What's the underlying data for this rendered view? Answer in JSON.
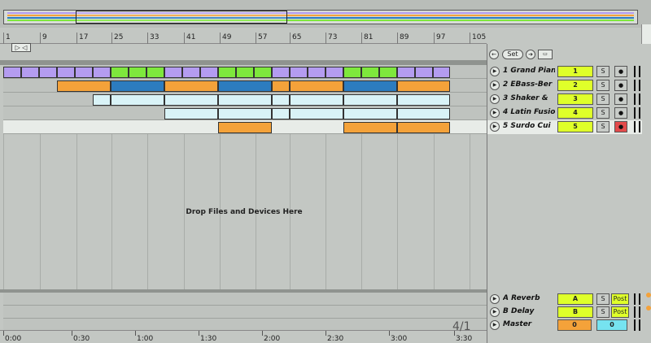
{
  "ruler": {
    "bars": [
      "1",
      "9",
      "17",
      "25",
      "33",
      "41",
      "49",
      "57",
      "65",
      "73",
      "81",
      "89",
      "97",
      "105"
    ]
  },
  "loop_brace": "▷ ◁",
  "drop_text": "Drop Files and Devices Here",
  "set_controls": {
    "prev": "←",
    "set": "Set",
    "next": "➔",
    "lock": "▭"
  },
  "colors": {
    "purple": "#b49cf0",
    "orange": "#f4a23a",
    "blue": "#2c7cbf",
    "green": "#7ee83c",
    "cyan": "#d9f3f7",
    "yellow": "#dfff2a",
    "red": "#e34b4b"
  },
  "tracks": [
    {
      "name": "1 Grand Pian",
      "num": "1",
      "solo": "S",
      "arm": "●",
      "armRed": false
    },
    {
      "name": "2 EBass-Ber",
      "num": "2",
      "solo": "S",
      "arm": "●",
      "armRed": false
    },
    {
      "name": "3 Shaker &",
      "num": "3",
      "solo": "S",
      "arm": "●",
      "armRed": false
    },
    {
      "name": "4 Latin Fusio",
      "num": "4",
      "solo": "S",
      "arm": "●",
      "armRed": false
    },
    {
      "name": "5 Surdo Cui",
      "num": "5",
      "solo": "S",
      "arm": "●",
      "armRed": true
    }
  ],
  "returns": [
    {
      "name": "A Reverb",
      "num": "A",
      "solo": "S",
      "post": "Post"
    },
    {
      "name": "B Delay",
      "num": "B",
      "solo": "S",
      "post": "Post"
    },
    {
      "name": "Master",
      "num": "0",
      "num2": "0"
    }
  ],
  "time_ruler": [
    "0:00",
    "0:30",
    "1:00",
    "1:30",
    "2:00",
    "2:30",
    "3:00",
    "3:30"
  ],
  "time_signature": "4/1"
}
